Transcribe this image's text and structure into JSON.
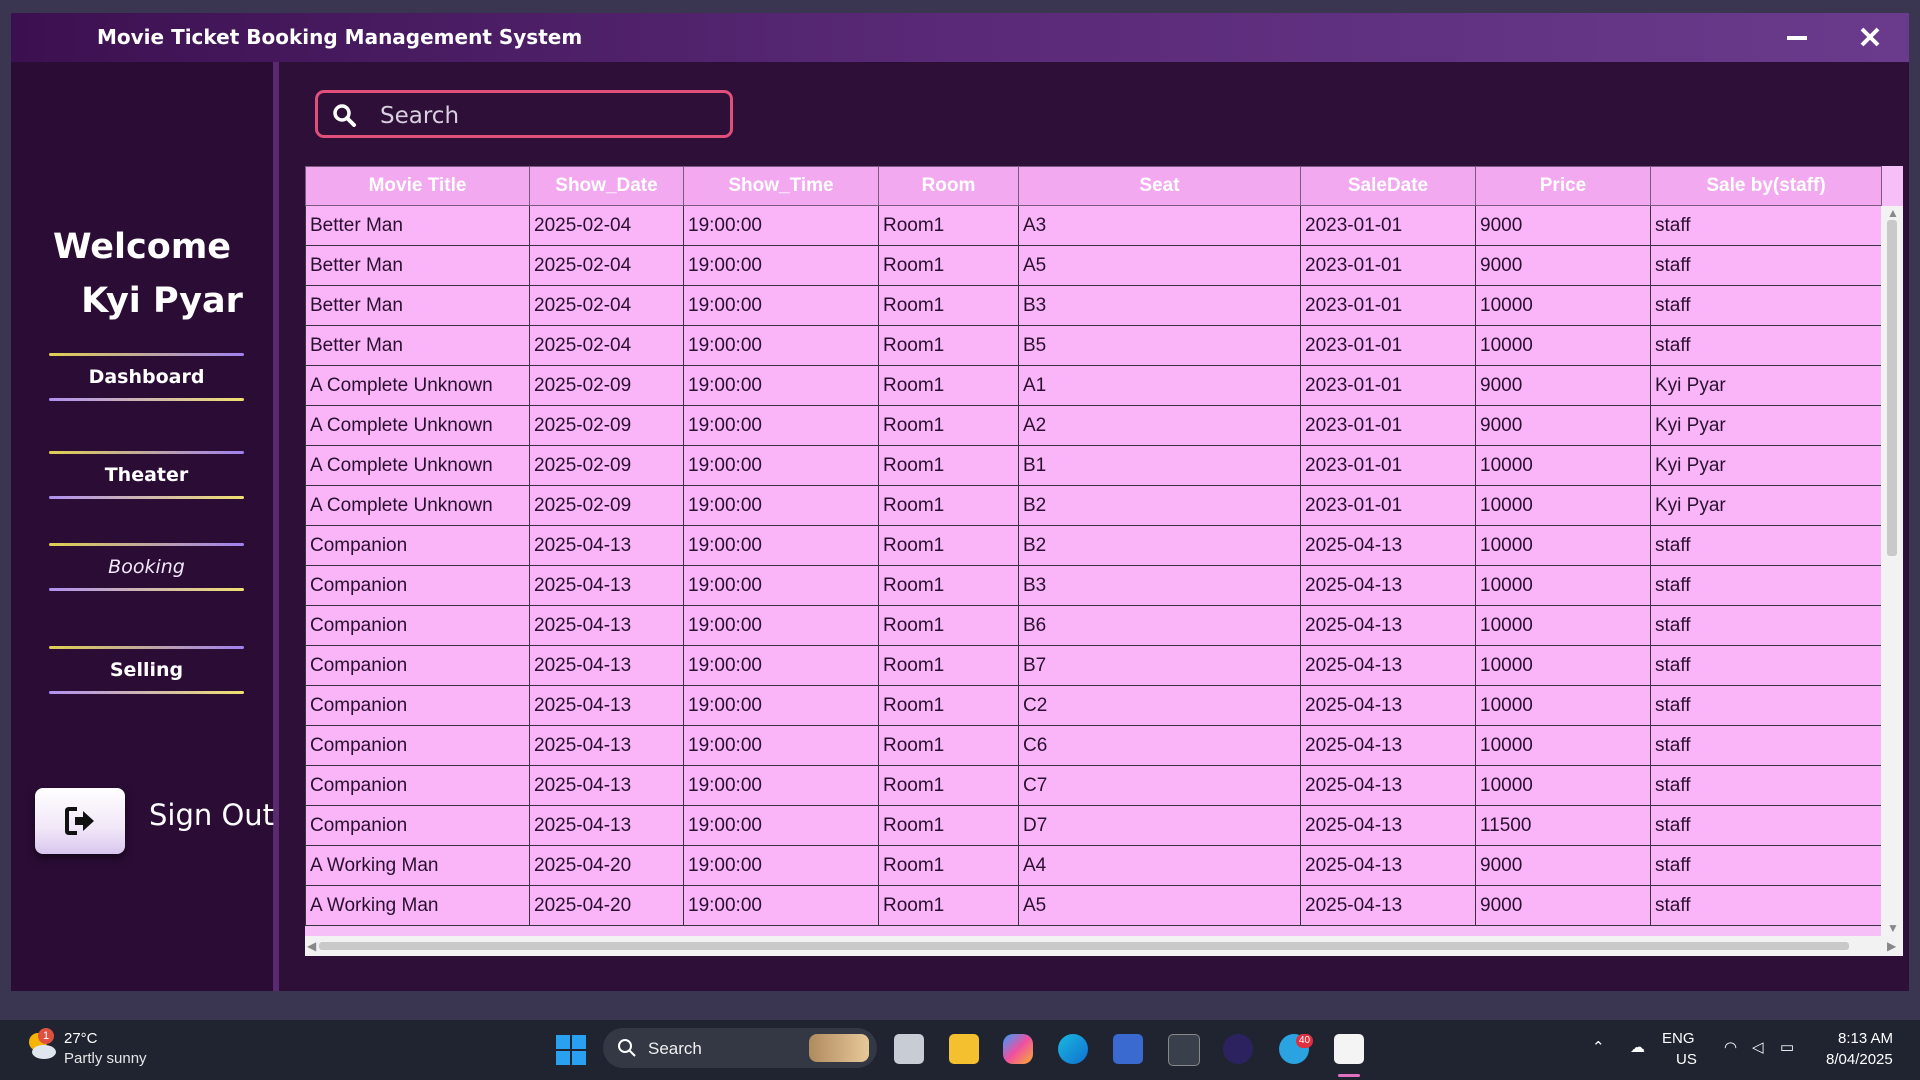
{
  "window": {
    "title": "Movie Ticket Booking Management System",
    "minimize_glyph": "—",
    "close_glyph": "✕"
  },
  "sidebar": {
    "welcome": "Welcome",
    "username": "Kyi Pyar",
    "nav": [
      {
        "label": "Dashboard",
        "icon": ""
      },
      {
        "label": "Theater",
        "icon": ""
      },
      {
        "label": "Booking",
        "icon": ""
      },
      {
        "label": "Selling",
        "icon": ""
      }
    ],
    "signout": {
      "label": "Sign Out",
      "icon": "sign-out-icon"
    }
  },
  "search": {
    "placeholder": "Search",
    "value": "",
    "icon": "search-icon"
  },
  "table": {
    "columns": [
      "Movie Title",
      "Show_Date",
      "Show_Time",
      "Room",
      "Seat",
      "SaleDate",
      "Price",
      "Sale by(staff)"
    ],
    "rows": [
      [
        "Better Man",
        "2025-02-04",
        "19:00:00",
        "Room1",
        "A3",
        "2023-01-01",
        "9000",
        "staff"
      ],
      [
        "Better Man",
        "2025-02-04",
        "19:00:00",
        "Room1",
        "A5",
        "2023-01-01",
        "9000",
        "staff"
      ],
      [
        "Better Man",
        "2025-02-04",
        "19:00:00",
        "Room1",
        "B3",
        "2023-01-01",
        "10000",
        "staff"
      ],
      [
        "Better Man",
        "2025-02-04",
        "19:00:00",
        "Room1",
        "B5",
        "2023-01-01",
        "10000",
        "staff"
      ],
      [
        "A Complete Unknown",
        "2025-02-09",
        "19:00:00",
        "Room1",
        "A1",
        "2023-01-01",
        "9000",
        "Kyi Pyar"
      ],
      [
        "A Complete Unknown",
        "2025-02-09",
        "19:00:00",
        "Room1",
        "A2",
        "2023-01-01",
        "9000",
        "Kyi Pyar"
      ],
      [
        "A Complete Unknown",
        "2025-02-09",
        "19:00:00",
        "Room1",
        "B1",
        "2023-01-01",
        "10000",
        "Kyi Pyar"
      ],
      [
        "A Complete Unknown",
        "2025-02-09",
        "19:00:00",
        "Room1",
        "B2",
        "2023-01-01",
        "10000",
        "Kyi Pyar"
      ],
      [
        "Companion",
        "2025-04-13",
        "19:00:00",
        "Room1",
        "B2",
        "2025-04-13",
        "10000",
        "staff"
      ],
      [
        "Companion",
        "2025-04-13",
        "19:00:00",
        "Room1",
        "B3",
        "2025-04-13",
        "10000",
        "staff"
      ],
      [
        "Companion",
        "2025-04-13",
        "19:00:00",
        "Room1",
        "B6",
        "2025-04-13",
        "10000",
        "staff"
      ],
      [
        "Companion",
        "2025-04-13",
        "19:00:00",
        "Room1",
        "B7",
        "2025-04-13",
        "10000",
        "staff"
      ],
      [
        "Companion",
        "2025-04-13",
        "19:00:00",
        "Room1",
        "C2",
        "2025-04-13",
        "10000",
        "staff"
      ],
      [
        "Companion",
        "2025-04-13",
        "19:00:00",
        "Room1",
        "C6",
        "2025-04-13",
        "10000",
        "staff"
      ],
      [
        "Companion",
        "2025-04-13",
        "19:00:00",
        "Room1",
        "C7",
        "2025-04-13",
        "10000",
        "staff"
      ],
      [
        "Companion",
        "2025-04-13",
        "19:00:00",
        "Room1",
        "D7",
        "2025-04-13",
        "11500",
        "staff"
      ],
      [
        "A Working Man",
        "2025-04-20",
        "19:00:00",
        "Room1",
        "A4",
        "2025-04-13",
        "9000",
        "staff"
      ],
      [
        "A Working Man",
        "2025-04-20",
        "19:00:00",
        "Room1",
        "A5",
        "2025-04-13",
        "9000",
        "staff"
      ]
    ]
  },
  "taskbar": {
    "weather": {
      "temp": "27°C",
      "desc": "Partly sunny",
      "badge": "1",
      "icon": "partly-sunny-icon"
    },
    "search_label": "Search",
    "apps": [
      {
        "name": "task-view-icon"
      },
      {
        "name": "file-explorer-icon"
      },
      {
        "name": "copilot-icon"
      },
      {
        "name": "edge-browser-icon"
      },
      {
        "name": "microsoft-store-icon"
      },
      {
        "name": "terminal-icon"
      },
      {
        "name": "eclipse-icon"
      },
      {
        "name": "telegram-icon",
        "badge": "40"
      },
      {
        "name": "java-app-icon"
      }
    ],
    "tray": {
      "lang": "ENG",
      "region": "US",
      "time": "8:13 AM",
      "date": "8/04/2025"
    }
  },
  "colors": {
    "window_bg": "#2e0f38",
    "title_bar": "#5a2a78",
    "table_header": "#f2a9f0",
    "table_cell": "#f9b5f8",
    "search_border": "#e0507a"
  }
}
